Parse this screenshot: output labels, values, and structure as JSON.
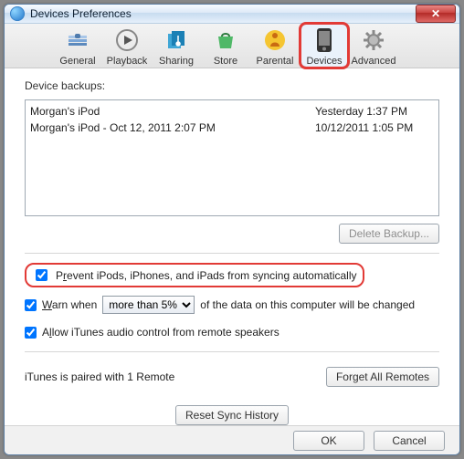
{
  "window": {
    "title": "Devices Preferences"
  },
  "toolbar": {
    "tabs": [
      {
        "label": "General"
      },
      {
        "label": "Playback"
      },
      {
        "label": "Sharing"
      },
      {
        "label": "Store"
      },
      {
        "label": "Parental"
      },
      {
        "label": "Devices"
      },
      {
        "label": "Advanced"
      }
    ]
  },
  "backups": {
    "label": "Device backups:",
    "rows": [
      {
        "name": "Morgan's iPod",
        "time": "Yesterday 1:37 PM"
      },
      {
        "name": "Morgan's iPod - Oct 12, 2011 2:07 PM",
        "time": "10/12/2011 1:05 PM"
      }
    ],
    "delete_label": "Delete Backup..."
  },
  "prevent": {
    "checked": true,
    "text_before": "P",
    "text_under": "r",
    "text_after": "event iPods, iPhones, and iPads from syncing automatically"
  },
  "warn": {
    "checked": true,
    "text_before_under": "W",
    "text_after_under": "arn when",
    "dropdown_value": "more than 5%",
    "text_after_dropdown": "of the data on this computer will be changed"
  },
  "audio": {
    "checked": true,
    "text_before": "A",
    "text_under": "l",
    "text_after": "low iTunes audio control from remote speakers"
  },
  "remotes": {
    "status": "iTunes is paired with 1 Remote",
    "forget_label": "Forget All Remotes"
  },
  "reset_label": "Reset Sync History",
  "footer": {
    "ok": "OK",
    "cancel": "Cancel"
  }
}
